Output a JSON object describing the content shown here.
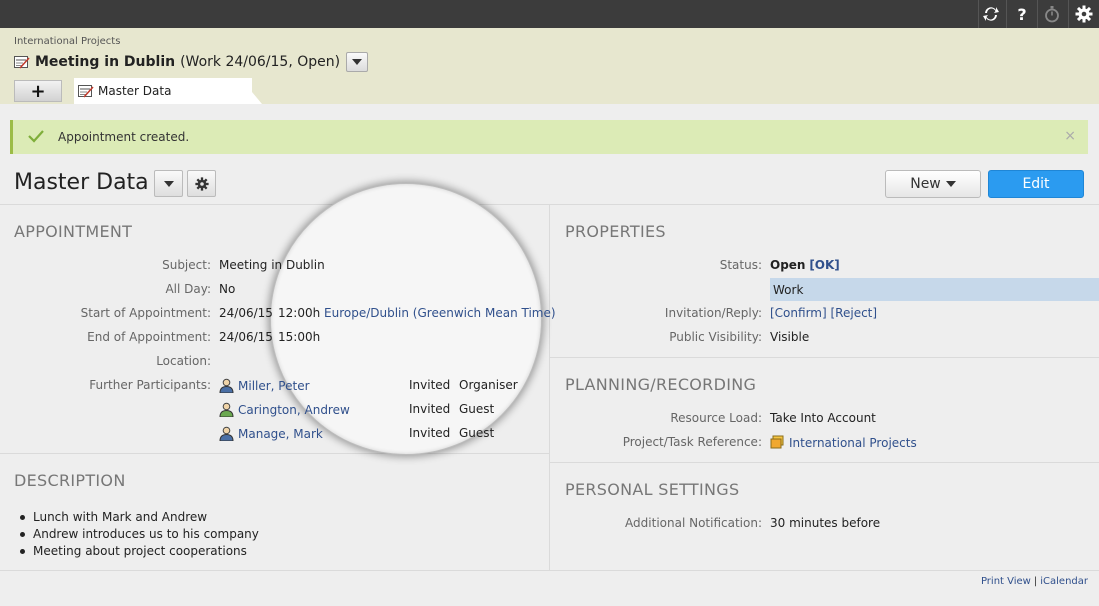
{
  "topbar": {
    "icons": [
      "sync-icon",
      "help-icon",
      "stopwatch-icon",
      "settings-gear-icon"
    ],
    "help_glyph": "?"
  },
  "header": {
    "breadcrumb": "International Projects",
    "title": "Meeting in Dublin",
    "subtitle": "(Work 24/06/15, Open)",
    "add_tab_label": "+",
    "active_tab_label": "Master Data"
  },
  "alert": {
    "message": "Appointment created.",
    "close_glyph": "×",
    "accent_color": "#9cbc47"
  },
  "page": {
    "title": "Master Data",
    "new_button": "New",
    "edit_button": "Edit",
    "accent_color": "#2b9bf0"
  },
  "appointment": {
    "section_title": "APPOINTMENT",
    "subject_label": "Subject:",
    "subject": "Meeting in Dublin",
    "allday_label": "All Day:",
    "allday": "No",
    "start_label": "Start of Appointment:",
    "start_date": "24/06/15",
    "start_time": "12:00h",
    "timezone": "Europe/Dublin (Greenwich Mean Time)",
    "end_label": "End of Appointment:",
    "end_date": "24/06/15",
    "end_time": "15:00h",
    "location_label": "Location:",
    "participants_label": "Further Participants:",
    "participants": [
      {
        "name": "Miller, Peter",
        "status": "Invited",
        "role": "Organiser"
      },
      {
        "name": "Carington, Andrew",
        "status": "Invited",
        "role": "Guest"
      },
      {
        "name": "Manage, Mark",
        "status": "Invited",
        "role": "Guest"
      }
    ]
  },
  "description": {
    "section_title": "DESCRIPTION",
    "items": [
      "Lunch with Mark and Andrew",
      "Andrew introduces us to his company",
      "Meeting about project cooperations"
    ]
  },
  "properties": {
    "section_title": "PROPERTIES",
    "status_label": "Status:",
    "status": "Open",
    "status_link": "[OK]",
    "category": "Work",
    "invitation_label": "Invitation/Reply:",
    "confirm_link": "[Confirm]",
    "reject_link": "[Reject]",
    "visibility_label": "Public Visibility:",
    "visibility": "Visible"
  },
  "planning": {
    "section_title": "PLANNING/RECORDING",
    "resource_label": "Resource Load:",
    "resource": "Take Into Account",
    "project_label": "Project/Task Reference:",
    "project": "International Projects"
  },
  "personal": {
    "section_title": "PERSONAL SETTINGS",
    "notification_label": "Additional Notification:",
    "notification": "30 minutes before"
  },
  "footer": {
    "print_view": "Print View",
    "separator": "|",
    "icalendar": "iCalendar"
  }
}
